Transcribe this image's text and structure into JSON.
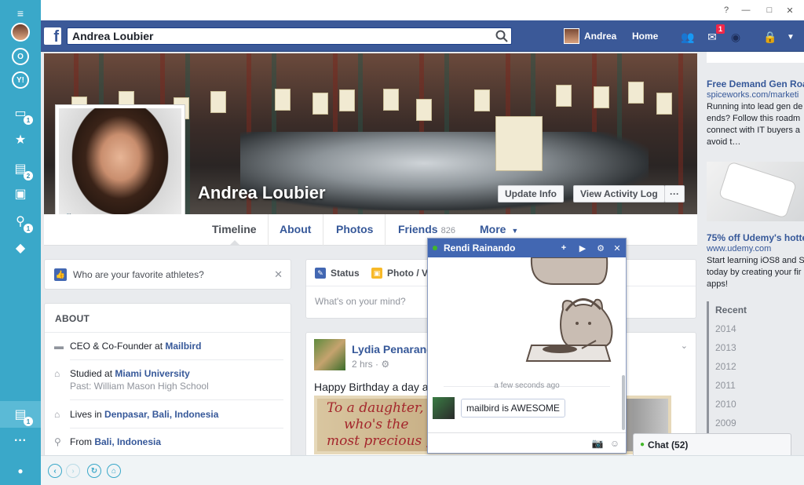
{
  "window": {
    "help": "?",
    "minimize": "—",
    "maximize": "□",
    "close": "✕"
  },
  "rail": {
    "badges": {
      "inbox": "1",
      "docs": "2",
      "people": "1",
      "unread": "1"
    }
  },
  "fb": {
    "search_value": "Andrea Loubier",
    "user_name": "Andrea",
    "home_label": "Home",
    "notification_count": "1"
  },
  "profile": {
    "name": "Andrea Loubier",
    "update_info": "Update Info",
    "view_activity_log": "View Activity Log",
    "more_dots": "···",
    "tabs": {
      "timeline": "Timeline",
      "about": "About",
      "photos": "Photos",
      "friends": "Friends",
      "friends_count": "826",
      "more": "More"
    }
  },
  "left": {
    "question": "Who are your favorite athletes?",
    "about_title": "ABOUT",
    "rows": [
      {
        "prefix": "CEO & Co-Founder at ",
        "link": "Mailbird",
        "sub": ""
      },
      {
        "prefix": "Studied at ",
        "link": "Miami University",
        "sub": "Past: William Mason High School"
      },
      {
        "prefix": "Lives in ",
        "link": "Denpasar, Bali, Indonesia",
        "sub": ""
      },
      {
        "prefix": "From ",
        "link": "Bali, Indonesia",
        "sub": ""
      }
    ]
  },
  "composer": {
    "status": "Status",
    "photo": "Photo / V",
    "placeholder": "What's on your mind?"
  },
  "post": {
    "author": "Lydia Penarand",
    "time": "2 hrs ·",
    "text": "Happy Birthday a day ah",
    "image_text": [
      "To a daughter,",
      "who's the",
      "most precious gi"
    ]
  },
  "ads": [
    {
      "title": "Free Demand Gen Roa",
      "link": "spiceworks.com/marketi",
      "text": "Running into lead gen de\nends? Follow this roadm\nconnect with IT buyers a\navoid t…"
    },
    {
      "title": "75% off Udemy's hottes",
      "link": "www.udemy.com",
      "text": "Start learning iOS8 and S\ntoday by creating your fir\napps!"
    }
  ],
  "years": [
    "Recent",
    "2014",
    "2013",
    "2012",
    "2011",
    "2010",
    "2009",
    "2008"
  ],
  "chat": {
    "contact": "Rendi Rainando",
    "timestamp": "a few seconds ago",
    "message": "mailbird is AWESOME",
    "chatbar_label": "Chat (52)"
  }
}
